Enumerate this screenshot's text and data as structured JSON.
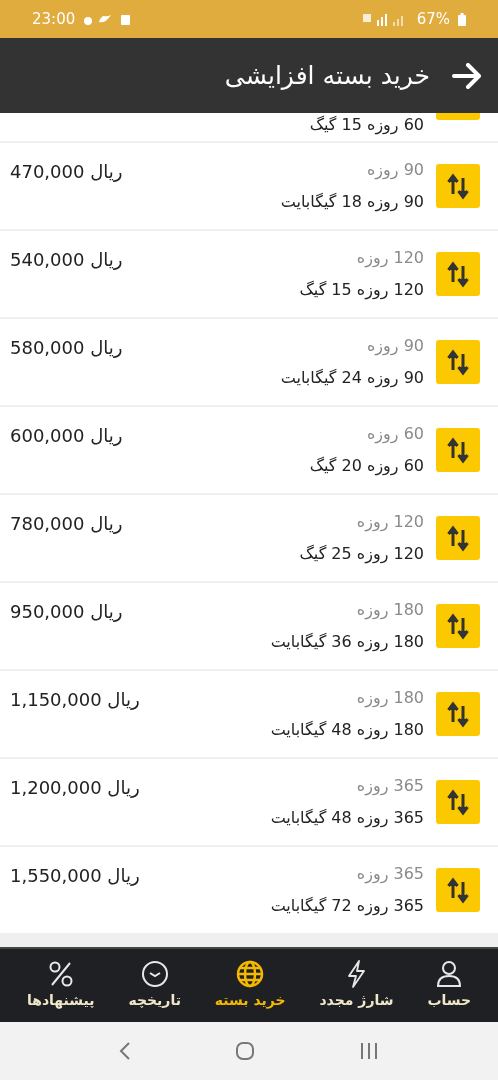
{
  "status_bar": {
    "time": "23:00",
    "battery": "67%"
  },
  "header": {
    "title": "خرید بسته افزایشی"
  },
  "partial_package": {
    "description": "60 روزه 15 گیگ"
  },
  "packages": [
    {
      "duration": "90 روزه",
      "description": "90 روزه 18 گیگابایت",
      "price": "470,000 ریال"
    },
    {
      "duration": "120 روزه",
      "description": "120 روزه 15 گیگ",
      "price": "540,000 ریال"
    },
    {
      "duration": "90 روزه",
      "description": "90 روزه 24 گیگابایت",
      "price": "580,000 ریال"
    },
    {
      "duration": "60 روزه",
      "description": "60 روزه 20 گیگ",
      "price": "600,000 ریال"
    },
    {
      "duration": "120 روزه",
      "description": "120 روزه 25 گیگ",
      "price": "780,000 ریال"
    },
    {
      "duration": "180 روزه",
      "description": "180 روزه 36 گیگابایت",
      "price": "950,000 ریال"
    },
    {
      "duration": "180 روزه",
      "description": "180 روزه 48 گیگابایت",
      "price": "1,150,000 ریال"
    },
    {
      "duration": "365 روزه",
      "description": "365 روزه 48 گیگابایت",
      "price": "1,200,000 ریال"
    },
    {
      "duration": "365 روزه",
      "description": "365 روزه 72 گیگابایت",
      "price": "1,550,000 ریال"
    }
  ],
  "bottom_nav": [
    {
      "kind": "account",
      "label": "حساب",
      "selected": false
    },
    {
      "kind": "recharge",
      "label": "شارژ مجدد",
      "selected": false
    },
    {
      "kind": "package",
      "label": "خرید بسته",
      "selected": true
    },
    {
      "kind": "history",
      "label": "تاریخچه",
      "selected": false
    },
    {
      "kind": "offers",
      "label": "پیشنهادها",
      "selected": false
    }
  ]
}
